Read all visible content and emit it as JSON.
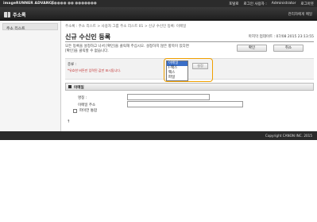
{
  "topbar": {
    "product": "imageRUNNER ADVANCE",
    "device": "●●●●● ●● ●●●●●●●",
    "links": [
      "포탈로",
      "로그인 사용자 :",
      "Administrator",
      "로그아웃"
    ]
  },
  "header": {
    "title": "주소록",
    "mode_label": "관리자에게 메일"
  },
  "sidebar": {
    "items": [
      "주소 리스트"
    ]
  },
  "main": {
    "breadcrumb": "주소록 : 주소 리스트 > 사용자 그룹 주소 리스트 01 > 신규 수신인 등록: 이메일",
    "title": "신규 수신인 등록",
    "updated": "마지막 업데이트 : 07/08 2015 23:13:55",
    "instructions": "모든 등록을 설정하고 나서 [확인]을 클릭해 주십시오. 설정하지 않은 항목이 있다면 [확인]을 클릭할 수 없습니다.",
    "ok_label": "확인",
    "cancel_label": "취소",
    "type_label": "종류 :",
    "type_note": "*유효한 버튼만 입력된 값만 표시됩니다.",
    "type_options": [
      "이메일",
      "I-팩스",
      "팩스",
      "파일"
    ],
    "selected_index": 0,
    "set_label": "설정",
    "section_title": "이메일",
    "name_label": "명칭 :",
    "email_label": "이메일 주소",
    "checkbox_label": "파이언 통합",
    "top_label": "↑"
  },
  "footer": {
    "copyright": "Copyright CANON INC. 2015"
  },
  "colors": {
    "highlight": "#f0a000",
    "selected_option": "#3a6ec7",
    "header": "#2b2b2b"
  }
}
